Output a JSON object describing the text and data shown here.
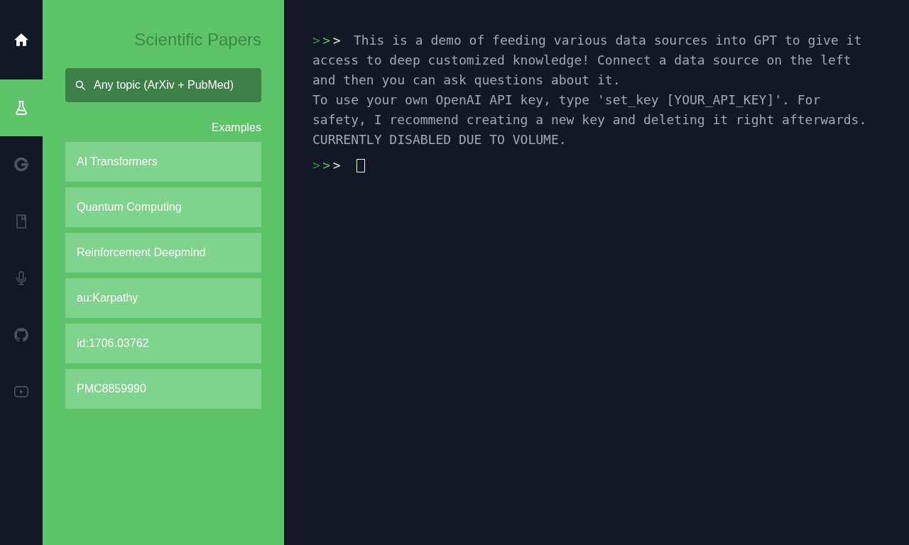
{
  "nav": {
    "items": [
      {
        "selected": true
      },
      {
        "selected": false
      },
      {
        "selected": false
      },
      {
        "selected": false
      },
      {
        "selected": false
      },
      {
        "selected": false
      }
    ]
  },
  "panel": {
    "title": "Scientific Papers",
    "search": {
      "placeholder": "Any topic (ArXiv + PubMed)"
    },
    "examples_label": "Examples",
    "examples": [
      "AI Transformers",
      "Quantum Computing",
      "Reinforcement Deepmind",
      "au:Karpathy",
      "id:1706.03762",
      "PMC8859990"
    ]
  },
  "terminal": {
    "prompt": ">>>",
    "message": [
      "This is a demo of feeding various data sources into GPT to give it",
      "access to deep customized knowledge! Connect a data source on the left and then you can ask questions about it.",
      "To use your own OpenAI API key, type 'set_key [YOUR_API_KEY]'. For safety, I recommend creating a new key and deleting it right afterwards.",
      "CURRENTLY DISABLED DUE TO VOLUME."
    ],
    "input_prompt": ">>>"
  }
}
